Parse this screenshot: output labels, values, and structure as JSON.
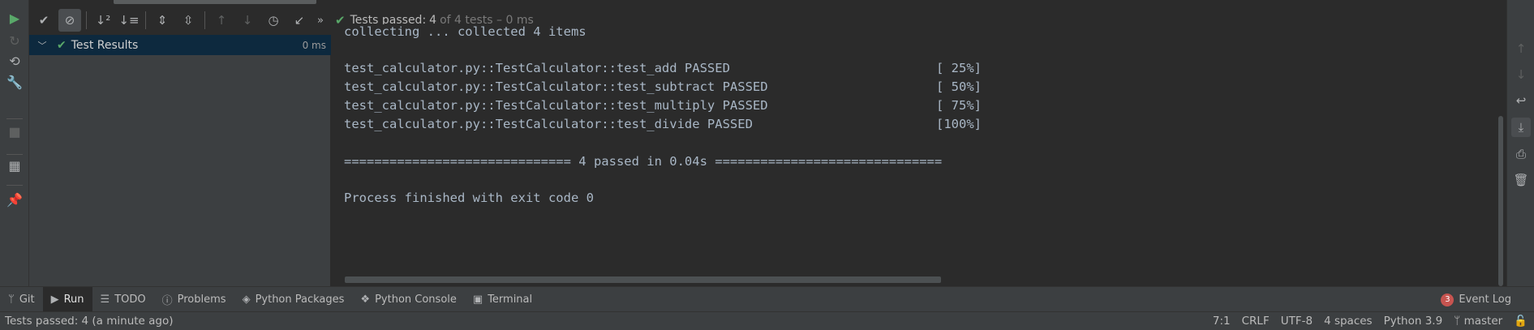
{
  "toolbar": {
    "status": {
      "label": "Tests passed:",
      "count": "4",
      "detail": "of 4 tests – 0 ms"
    },
    "icons": [
      "show-passed-icon",
      "show-ignored-icon",
      "sort-alpha-icon",
      "sort-duration-icon",
      "expand-all-icon",
      "collapse-all-icon",
      "prev-failed-icon",
      "next-failed-icon",
      "history-icon",
      "import-tests-icon",
      "more-icon"
    ]
  },
  "tree": {
    "root": {
      "label": "Test Results",
      "time": "0 ms"
    }
  },
  "console": {
    "lines": [
      {
        "text": "collecting ... collected 4 items",
        "pct": ""
      },
      {
        "text": "",
        "pct": ""
      },
      {
        "text": "test_calculator.py::TestCalculator::test_add PASSED",
        "pct": "[ 25%]"
      },
      {
        "text": "test_calculator.py::TestCalculator::test_subtract PASSED",
        "pct": "[ 50%]"
      },
      {
        "text": "test_calculator.py::TestCalculator::test_multiply PASSED",
        "pct": "[ 75%]"
      },
      {
        "text": "test_calculator.py::TestCalculator::test_divide PASSED",
        "pct": "[100%]"
      },
      {
        "text": "",
        "pct": ""
      },
      {
        "text": "============================== 4 passed in 0.04s ==============================",
        "pct": ""
      },
      {
        "text": "",
        "pct": ""
      },
      {
        "text": "Process finished with exit code 0",
        "pct": ""
      }
    ]
  },
  "bottom_tabs": [
    {
      "label": "Git",
      "icon": "git-icon"
    },
    {
      "label": "Run",
      "icon": "run-icon"
    },
    {
      "label": "TODO",
      "icon": "todo-icon"
    },
    {
      "label": "Problems",
      "icon": "problems-icon"
    },
    {
      "label": "Python Packages",
      "icon": "python-packages-icon"
    },
    {
      "label": "Python Console",
      "icon": "python-console-icon"
    },
    {
      "label": "Terminal",
      "icon": "terminal-icon"
    }
  ],
  "event_log": {
    "badge": "3",
    "label": "Event Log"
  },
  "statusbar": {
    "message": "Tests passed: 4 (a minute ago)",
    "position": "7:1",
    "line_separator": "CRLF",
    "encoding": "UTF-8",
    "indent": "4 spaces",
    "interpreter": "Python 3.9",
    "branch": "master"
  },
  "colors": {
    "pass_green": "#59a869",
    "selection": "#0d293e",
    "badge_red": "#c75450"
  }
}
